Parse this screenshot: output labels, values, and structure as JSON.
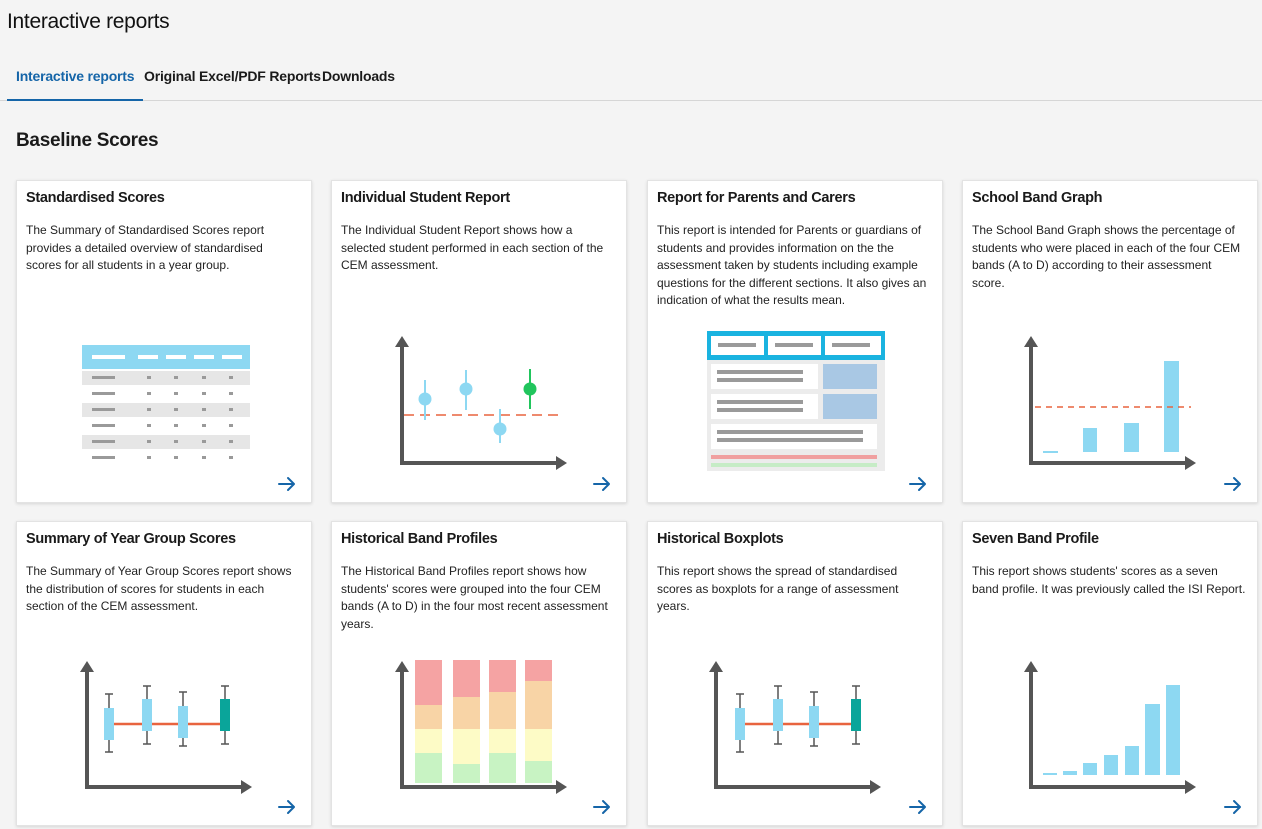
{
  "page": {
    "title": "Interactive reports"
  },
  "tabs": [
    {
      "label": "Interactive reports",
      "active": true
    },
    {
      "label": "Original Excel/PDF Reports",
      "active": false
    },
    {
      "label": "Downloads",
      "active": false
    }
  ],
  "section": {
    "title": "Baseline Scores"
  },
  "colors": {
    "accent": "#1565a8",
    "light_blue": "#8dd8f2",
    "axis": "#555555",
    "red_dash": "#e8643f",
    "green": "#21c55d",
    "teal": "#0aa59a"
  },
  "cards": [
    {
      "title": "Standardised Scores",
      "description": "The Summary of Standardised Scores report provides a detailed overview of standardised scores for all students in a year group.",
      "illustration": "table-illustration"
    },
    {
      "title": "Individual Student Report",
      "description": "The Individual Student Report shows how a selected student performed in each section of the CEM assessment.",
      "illustration": "student-chart-illustration"
    },
    {
      "title": "Report for Parents and Carers",
      "description": "This report is intended for Parents or guardians of students and provides information on the the assessment taken by students including example questions for the different sections. It also gives an indication of what the results mean.",
      "illustration": "document-illustration"
    },
    {
      "title": "School Band Graph",
      "description": "The School Band Graph shows the percentage of students who were placed in each of the four CEM bands (A to D) according to their assessment score.",
      "illustration": "band-bar-illustration"
    },
    {
      "title": "Summary of Year Group Scores",
      "description": "The Summary of Year Group Scores report shows the distribution of scores for students in each section of the CEM assessment.",
      "illustration": "boxplot-illustration"
    },
    {
      "title": "Historical Band Profiles",
      "description": "The Historical Band Profiles report shows how students' scores were grouped into the four CEM bands (A to D) in the four most recent assessment years.",
      "illustration": "stacked-bar-illustration"
    },
    {
      "title": "Historical Boxplots",
      "description": "This report shows the spread of standardised scores as boxplots for a range of assessment years.",
      "illustration": "boxplot-illustration"
    },
    {
      "title": "Seven Band Profile",
      "description": "This report shows students' scores as a seven band profile. It was previously called the ISI Report.",
      "illustration": "seven-band-illustration"
    }
  ],
  "card_action_icon": "arrow-right-icon"
}
